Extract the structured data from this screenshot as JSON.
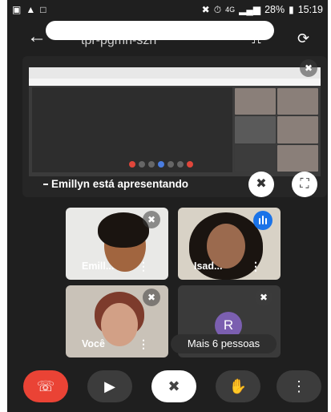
{
  "status_bar": {
    "battery": "28%",
    "time": "15:19",
    "network": "4G"
  },
  "top_bar": {
    "meeting_code": "tpr-pgmn-szn"
  },
  "presentation": {
    "presenting_label": "Emillyn está apresentando"
  },
  "participants": [
    {
      "name": "Emill...",
      "muted": true
    },
    {
      "name": "Isad...",
      "speaking": true
    },
    {
      "name": "Você",
      "muted": true
    },
    {
      "initial": "R",
      "muted": true
    }
  ],
  "more_people_label": "Mais 6 pessoas",
  "colors": {
    "end_call": "#ea4335",
    "speaking": "#1a73e8",
    "avatar": "#7b5fb0"
  }
}
